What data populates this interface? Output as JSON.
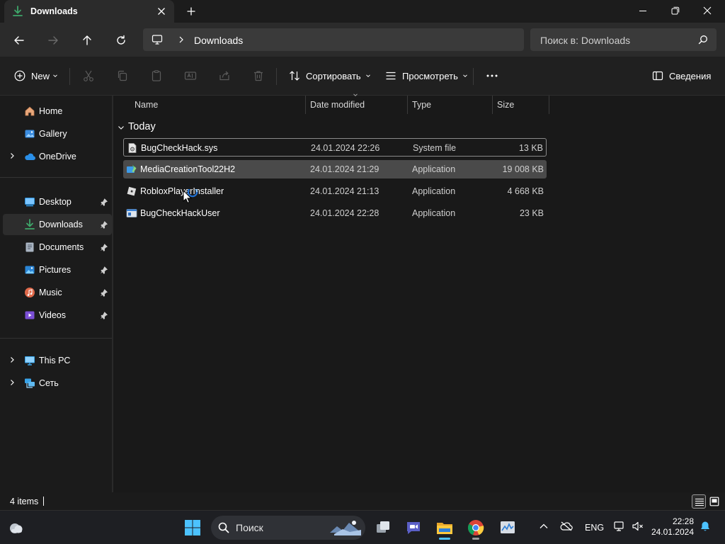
{
  "window": {
    "tab_title": "Downloads",
    "colors": {
      "accent": "#4cc2ff",
      "folder_green": "#3ea76a",
      "background": "#191919"
    }
  },
  "addressbar": {
    "breadcrumb": "Downloads",
    "search_placeholder": "Поиск в: Downloads"
  },
  "commandbar": {
    "new_label": "New",
    "sort_label": "Сортировать",
    "view_label": "Просмотреть",
    "details_label": "Сведения"
  },
  "sidebar": {
    "items": [
      {
        "label": "Home",
        "icon": "home-icon",
        "chevron": false,
        "pinned": false
      },
      {
        "label": "Gallery",
        "icon": "gallery-icon",
        "chevron": false,
        "pinned": false
      },
      {
        "label": "OneDrive",
        "icon": "onedrive-icon",
        "chevron": true,
        "pinned": false
      },
      {
        "label": "Desktop",
        "icon": "desktop-icon",
        "chevron": false,
        "pinned": true
      },
      {
        "label": "Downloads",
        "icon": "downloads-icon",
        "chevron": false,
        "pinned": true,
        "selected": true
      },
      {
        "label": "Documents",
        "icon": "documents-icon",
        "chevron": false,
        "pinned": true
      },
      {
        "label": "Pictures",
        "icon": "pictures-icon",
        "chevron": false,
        "pinned": true
      },
      {
        "label": "Music",
        "icon": "music-icon",
        "chevron": false,
        "pinned": true
      },
      {
        "label": "Videos",
        "icon": "videos-icon",
        "chevron": false,
        "pinned": true
      },
      {
        "label": "This PC",
        "icon": "this-pc-icon",
        "chevron": true,
        "pinned": false
      },
      {
        "label": "Сеть",
        "icon": "network-icon",
        "chevron": true,
        "pinned": false
      }
    ]
  },
  "filelist": {
    "columns": [
      "Name",
      "Date modified",
      "Type",
      "Size"
    ],
    "group_label": "Today",
    "files": [
      {
        "name": "BugCheckHack.sys",
        "date": "24.01.2024 22:26",
        "type": "System file",
        "size": "13 KB",
        "icon": "system-file-icon"
      },
      {
        "name": "MediaCreationTool22H2",
        "date": "24.01.2024 21:29",
        "type": "Application",
        "size": "19 008 KB",
        "icon": "media-creation-tool-icon"
      },
      {
        "name": "RobloxPlayerInstaller",
        "date": "24.01.2024 21:13",
        "type": "Application",
        "size": "4 668 KB",
        "icon": "roblox-icon"
      },
      {
        "name": "BugCheckHackUser",
        "date": "24.01.2024 22:28",
        "type": "Application",
        "size": "23 KB",
        "icon": "application-icon"
      }
    ]
  },
  "statusbar": {
    "item_count": "4 items"
  },
  "taskbar": {
    "search_label": "Поиск",
    "language": "ENG",
    "time": "22:28",
    "date": "24.01.2024"
  }
}
